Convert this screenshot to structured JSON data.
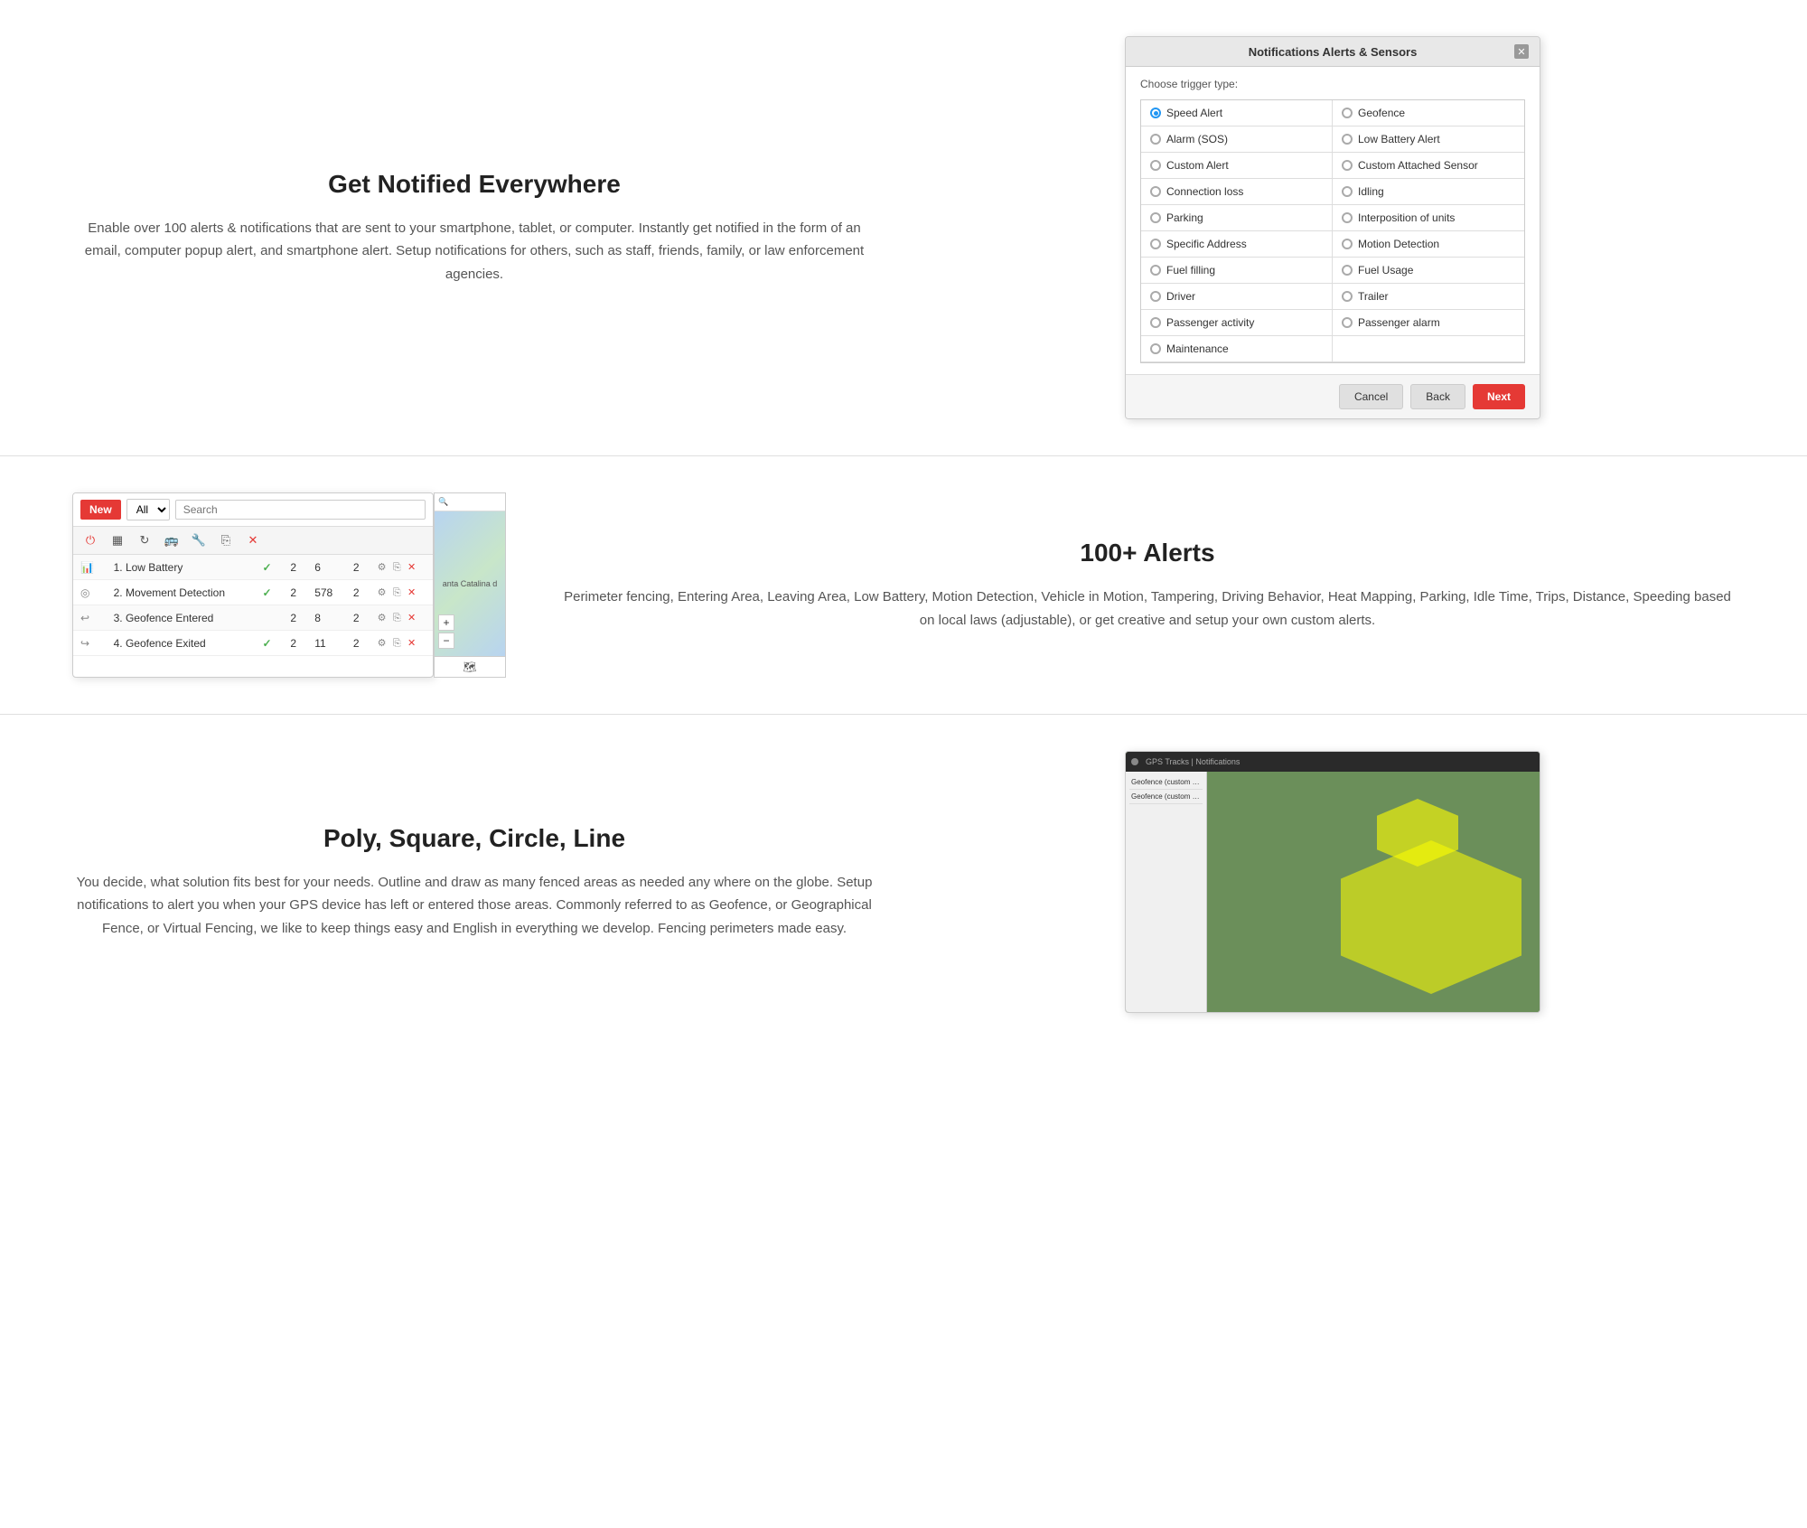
{
  "section1": {
    "title": "Get Notified Everywhere",
    "description": "Enable over 100 alerts & notifications that are sent to your smartphone, tablet, or computer. Instantly get notified in the form of an email, computer popup alert, and smartphone alert. Setup notifications for others, such as staff, friends, family, or law enforcement agencies.",
    "modal": {
      "title": "Notifications Alerts & Sensors",
      "trigger_label": "Choose trigger type:",
      "options_col1": [
        {
          "label": "Speed Alert",
          "selected": true
        },
        {
          "label": "Alarm (SOS)",
          "selected": false
        },
        {
          "label": "Custom Alert",
          "selected": false
        },
        {
          "label": "Connection loss",
          "selected": false
        },
        {
          "label": "Parking",
          "selected": false
        },
        {
          "label": "Specific Address",
          "selected": false
        },
        {
          "label": "Fuel filling",
          "selected": false
        },
        {
          "label": "Driver",
          "selected": false
        },
        {
          "label": "Passenger activity",
          "selected": false
        },
        {
          "label": "Maintenance",
          "selected": false
        }
      ],
      "options_col2": [
        {
          "label": "Geofence",
          "selected": false
        },
        {
          "label": "Low Battery Alert",
          "selected": false
        },
        {
          "label": "Custom Attached Sensor",
          "selected": false
        },
        {
          "label": "Idling",
          "selected": false
        },
        {
          "label": "Interposition of units",
          "selected": false
        },
        {
          "label": "Motion Detection",
          "selected": false
        },
        {
          "label": "Fuel Usage",
          "selected": false
        },
        {
          "label": "Trailer",
          "selected": false
        },
        {
          "label": "Passenger alarm",
          "selected": false
        }
      ],
      "btn_cancel": "Cancel",
      "btn_back": "Back",
      "btn_next": "Next"
    }
  },
  "section2": {
    "title": "100+ Alerts",
    "description": "Perimeter fencing, Entering Area, Leaving Area, Low Battery, Motion Detection, Vehicle in Motion, Tampering, Driving Behavior, Heat Mapping, Parking, Idle Time, Trips, Distance, Speeding based on local laws (adjustable), or get creative and setup your own custom alerts.",
    "toolbar": {
      "btn_new": "New",
      "select_all": "All",
      "search_placeholder": "Search"
    },
    "alerts": [
      {
        "icon": "bar-chart",
        "name": "1. Low Battery",
        "check": true,
        "col1": "2",
        "col2": "6",
        "col3": "2"
      },
      {
        "icon": "circle",
        "name": "2. Movement Detection",
        "check": true,
        "col1": "2",
        "col2": "578",
        "col3": "2"
      },
      {
        "icon": "arrow",
        "name": "3. Geofence Entered",
        "check": false,
        "col1": "2",
        "col2": "8",
        "col3": "2"
      },
      {
        "icon": "arrow",
        "name": "4. Geofence Exited",
        "check": true,
        "col1": "2",
        "col2": "11",
        "col3": "2"
      }
    ],
    "map": {
      "location_label": "anta Catalina d"
    }
  },
  "section3": {
    "title": "Poly, Square, Circle, Line",
    "description": "You decide, what solution fits best for your needs. Outline and draw as many fenced areas as needed any where on the globe. Setup notifications to alert you when your GPS device has left or entered those areas. Commonly referred to as Geofence, or Geographical Fence, or Virtual Fencing, we like to keep things easy and English in everything we develop. Fencing perimeters made easy.",
    "geofence": {
      "topbar_label": "GPS Tracks | Notifications",
      "sidebar_items": [
        "Geofence (custom poly)",
        "Geofence (custom poly)"
      ]
    }
  }
}
